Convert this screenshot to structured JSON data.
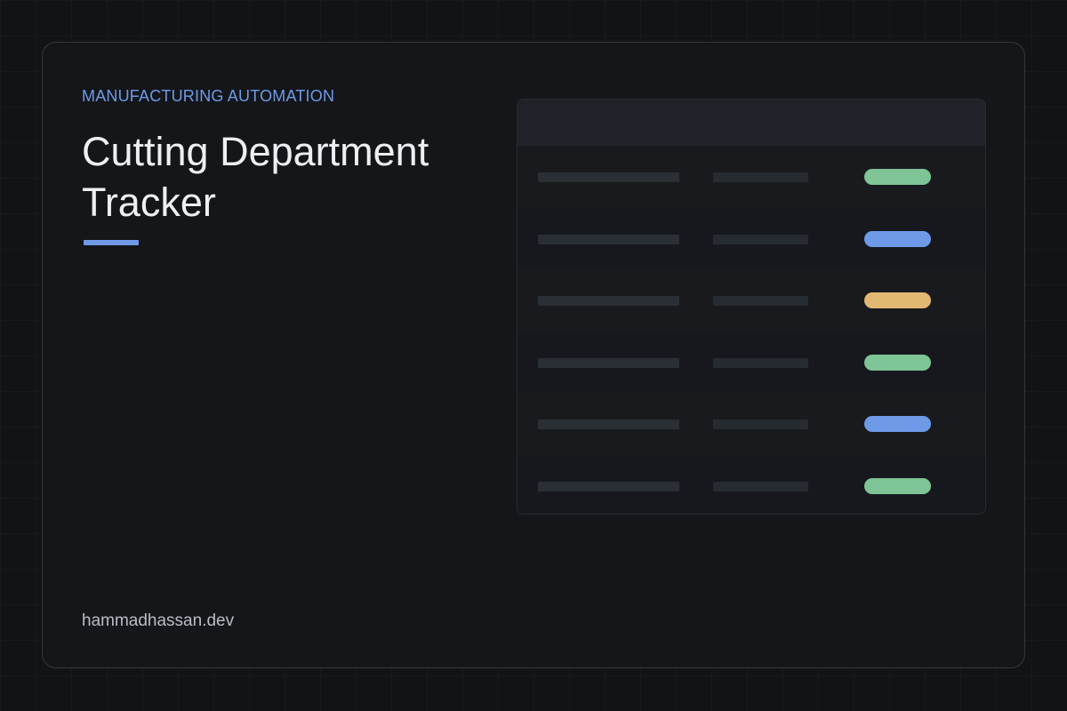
{
  "header": {
    "eyebrow": "MANUFACTURING AUTOMATION",
    "title": "Cutting Department Tracker"
  },
  "footer": {
    "domain": "hammadhassan.dev"
  },
  "colors": {
    "accent": "#6e9ae8",
    "status_green": "#7ec496",
    "status_blue": "#6e9ae8",
    "status_amber": "#e1b973"
  },
  "table_preview": {
    "rows": [
      {
        "status_color": "#7ec496"
      },
      {
        "status_color": "#6e9ae8"
      },
      {
        "status_color": "#e1b973"
      },
      {
        "status_color": "#7ec496"
      },
      {
        "status_color": "#6e9ae8"
      },
      {
        "status_color": "#7ec496"
      }
    ]
  }
}
